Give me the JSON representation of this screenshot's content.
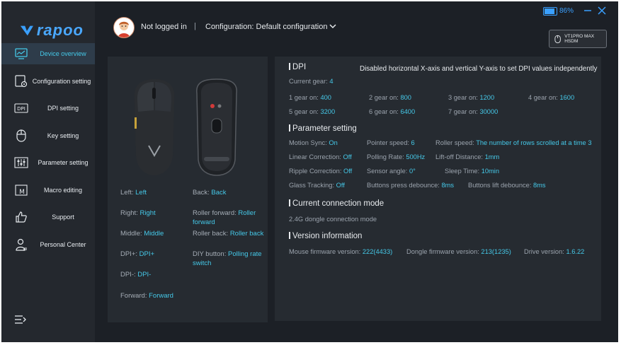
{
  "app": {
    "brand": "rapoo"
  },
  "sidebar": {
    "items": [
      {
        "label": "Device overview",
        "icon": "chart-monitor-icon",
        "active": true
      },
      {
        "label": "Configuration setting",
        "icon": "config-gear-icon"
      },
      {
        "label": "DPI setting",
        "icon": "dpi-icon"
      },
      {
        "label": "Key setting",
        "icon": "mouse-icon"
      },
      {
        "label": "Parameter setting",
        "icon": "sliders-icon"
      },
      {
        "label": "Macro editing",
        "icon": "macro-icon"
      },
      {
        "label": "Support",
        "icon": "thumbs-up-icon"
      },
      {
        "label": "Personal Center",
        "icon": "user-icon"
      }
    ],
    "menu_icon": "menu-collapse-icon"
  },
  "header": {
    "login_status": "Not logged in",
    "separator": "|",
    "configuration": "Configuration: Default configuration",
    "battery_percent": "86%",
    "battery_level": 0.86,
    "device_name": "VT1PRO MAX HSDM"
  },
  "buttons": {
    "left": {
      "key": "Left:",
      "value": "Left"
    },
    "right": {
      "key": "Right:",
      "value": "Right"
    },
    "middle": {
      "key": "Middle:",
      "value": "Middle"
    },
    "dpi_plus": {
      "key": "DPI+:",
      "value": "DPI+"
    },
    "dpi_minus": {
      "key": "DPI-:",
      "value": "DPI-"
    },
    "forward": {
      "key": "Forward:",
      "value": "Forward"
    },
    "back": {
      "key": "Back:",
      "value": "Back"
    },
    "roller_forward": {
      "key": "Roller forward:",
      "value": "Roller forward"
    },
    "roller_back": {
      "key": "Roller back:",
      "value": "Roller back"
    },
    "diy": {
      "key": "DIY button:",
      "value": "Polling rate switch"
    }
  },
  "dpi": {
    "title": "DPI",
    "note": "Disabled horizontal X-axis and vertical Y-axis to set DPI values independently",
    "current_gear_label": "Current gear:",
    "current_gear": "4",
    "gears": [
      {
        "label": "1 gear on:",
        "value": "400"
      },
      {
        "label": "2 gear on:",
        "value": "800"
      },
      {
        "label": "3 gear on:",
        "value": "1200"
      },
      {
        "label": "4 gear on:",
        "value": "1600"
      },
      {
        "label": "5 gear on:",
        "value": "3200"
      },
      {
        "label": "6 gear on:",
        "value": "6400"
      },
      {
        "label": "7 gear on:",
        "value": "30000"
      }
    ]
  },
  "params": {
    "title": "Parameter setting",
    "motion_sync": {
      "label": "Motion Sync:",
      "value": "On"
    },
    "pointer_speed": {
      "label": "Pointer speed:",
      "value": "6"
    },
    "roller_speed": {
      "label": "Roller speed:",
      "value": "The number of rows scrolled at a time 3"
    },
    "linear": {
      "label": "Linear Correction:",
      "value": "Off"
    },
    "polling": {
      "label": "Polling Rate:",
      "value": "500Hz"
    },
    "liftoff": {
      "label": "Lift-off Distance:",
      "value": "1mm"
    },
    "ripple": {
      "label": "Ripple Correction:",
      "value": "Off"
    },
    "sensor_angle": {
      "label": "Sensor angle:",
      "value": "0°"
    },
    "sleep": {
      "label": "Sleep Time:",
      "value": "10min"
    },
    "glass": {
      "label": "Glass Tracking:",
      "value": "Off"
    },
    "press_debounce": {
      "label": "Buttons press debounce:",
      "value": "8ms"
    },
    "lift_debounce": {
      "label": "Buttons lift debounce:",
      "value": "8ms"
    }
  },
  "connection": {
    "title": "Current connection mode",
    "mode": "2.4G dongle connection mode"
  },
  "version": {
    "title": "Version information",
    "mouse": {
      "label": "Mouse firmware version:",
      "value": "222(4433)"
    },
    "dongle": {
      "label": "Dongle firmware version:",
      "value": "213(1235)"
    },
    "drive": {
      "label": "Drive version:",
      "value": "1.6.22"
    }
  },
  "colors": {
    "accent": "#45c8e8",
    "brand": "#3aa0ff",
    "background": "#1c2026"
  }
}
